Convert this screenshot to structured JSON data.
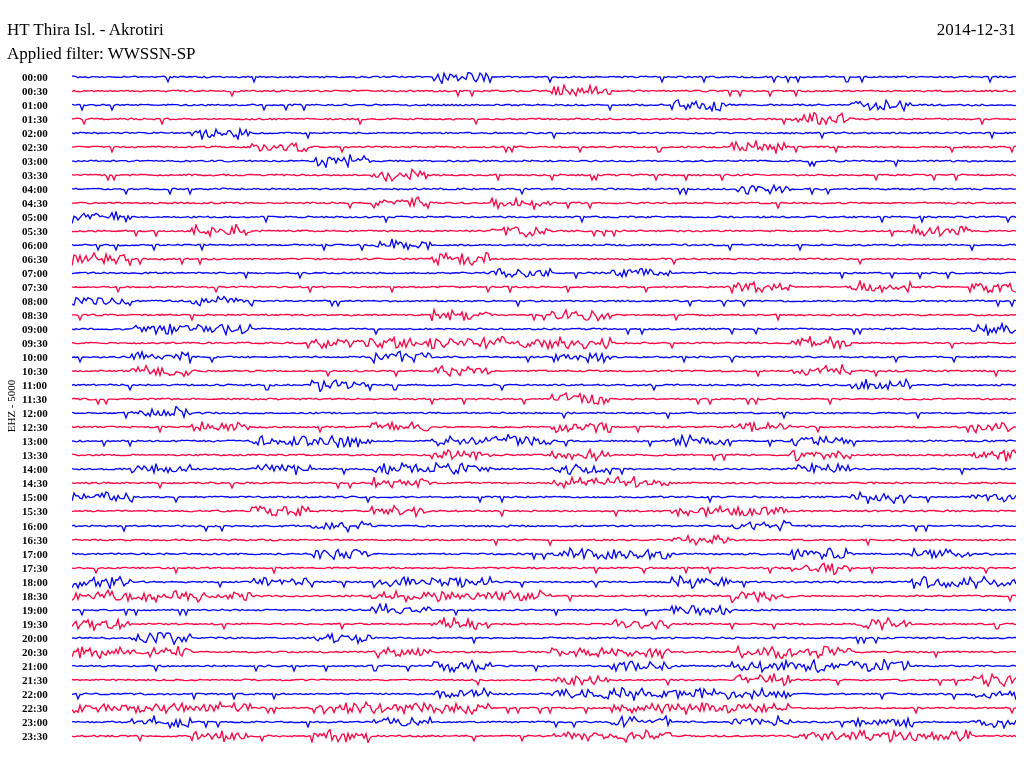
{
  "header": {
    "station": "HT Thira Isl. - Akrotiri",
    "date": "2014-12-31",
    "filter": "Applied filter: WWSSN-SP"
  },
  "axis_label": "EHZ - 5000",
  "rows": [
    {
      "time": "00:00",
      "color": "#0000ff"
    },
    {
      "time": "00:30",
      "color": "#ff0040"
    },
    {
      "time": "01:00",
      "color": "#0000ff"
    },
    {
      "time": "01:30",
      "color": "#ff0040"
    },
    {
      "time": "02:00",
      "color": "#0000ff"
    },
    {
      "time": "02:30",
      "color": "#ff0040"
    },
    {
      "time": "03:00",
      "color": "#0000ff"
    },
    {
      "time": "03:30",
      "color": "#ff0040"
    },
    {
      "time": "04:00",
      "color": "#0000ff"
    },
    {
      "time": "04:30",
      "color": "#ff0040"
    },
    {
      "time": "05:00",
      "color": "#0000ff"
    },
    {
      "time": "05:30",
      "color": "#ff0040"
    },
    {
      "time": "06:00",
      "color": "#0000ff"
    },
    {
      "time": "06:30",
      "color": "#ff0040"
    },
    {
      "time": "07:00",
      "color": "#0000ff"
    },
    {
      "time": "07:30",
      "color": "#ff0040"
    },
    {
      "time": "08:00",
      "color": "#0000ff"
    },
    {
      "time": "08:30",
      "color": "#ff0040"
    },
    {
      "time": "09:00",
      "color": "#0000ff"
    },
    {
      "time": "09:30",
      "color": "#ff0040"
    },
    {
      "time": "10:00",
      "color": "#0000ff"
    },
    {
      "time": "10:30",
      "color": "#ff0040"
    },
    {
      "time": "11:00",
      "color": "#0000ff"
    },
    {
      "time": "11:30",
      "color": "#ff0040"
    },
    {
      "time": "12:00",
      "color": "#0000ff"
    },
    {
      "time": "12:30",
      "color": "#ff0040"
    },
    {
      "time": "13:00",
      "color": "#0000ff"
    },
    {
      "time": "13:30",
      "color": "#ff0040"
    },
    {
      "time": "14:00",
      "color": "#0000ff"
    },
    {
      "time": "14:30",
      "color": "#ff0040"
    },
    {
      "time": "15:00",
      "color": "#0000ff"
    },
    {
      "time": "15:30",
      "color": "#ff0040"
    },
    {
      "time": "16:00",
      "color": "#0000ff"
    },
    {
      "time": "16:30",
      "color": "#ff0040"
    },
    {
      "time": "17:00",
      "color": "#0000ff"
    },
    {
      "time": "17:30",
      "color": "#ff0040"
    },
    {
      "time": "18:00",
      "color": "#0000ff"
    },
    {
      "time": "18:30",
      "color": "#ff0040"
    },
    {
      "time": "19:00",
      "color": "#0000ff"
    },
    {
      "time": "19:30",
      "color": "#ff0040"
    },
    {
      "time": "20:00",
      "color": "#0000ff"
    },
    {
      "time": "20:30",
      "color": "#ff0040"
    },
    {
      "time": "21:00",
      "color": "#0000ff"
    },
    {
      "time": "21:30",
      "color": "#ff0040"
    },
    {
      "time": "22:00",
      "color": "#0000ff"
    },
    {
      "time": "22:30",
      "color": "#ff0040"
    },
    {
      "time": "23:00",
      "color": "#0000ff"
    },
    {
      "time": "23:30",
      "color": "#ff0040"
    }
  ]
}
